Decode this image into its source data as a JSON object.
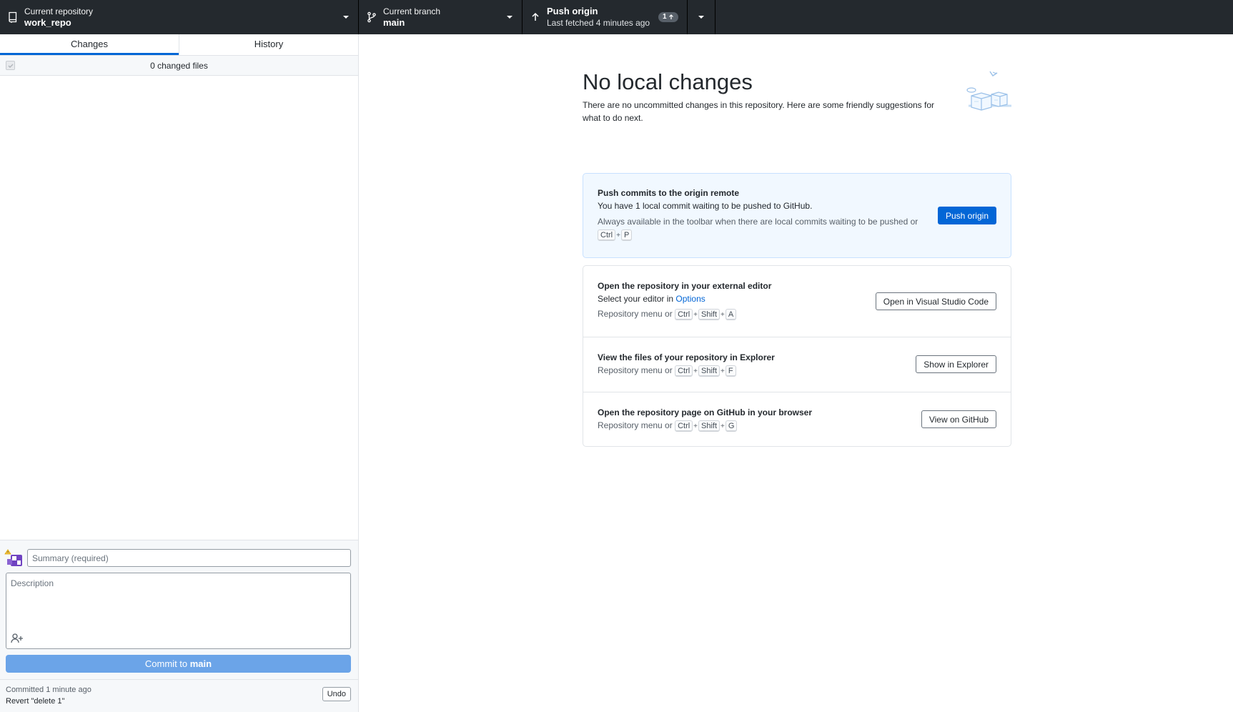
{
  "toolbar": {
    "repo": {
      "label": "Current repository",
      "value": "work_repo"
    },
    "branch": {
      "label": "Current branch",
      "value": "main"
    },
    "push": {
      "label": "Push origin",
      "subtext": "Last fetched 4 minutes ago",
      "ahead_count": "1"
    }
  },
  "sidebar": {
    "tabs": [
      {
        "label": "Changes",
        "selected": true
      },
      {
        "label": "History",
        "selected": false
      }
    ],
    "changed_files": "0 changed files",
    "commit": {
      "summary_placeholder": "Summary (required)",
      "description_placeholder": "Description",
      "button_prefix": "Commit to ",
      "button_branch": "main"
    },
    "undo": {
      "line1": "Committed 1 minute ago",
      "line2": "Revert \"delete 1\"",
      "button": "Undo"
    }
  },
  "main": {
    "title": "No local changes",
    "subtitle": "There are no uncommitted changes in this repository. Here are some friendly suggestions for what to do next.",
    "push_card": {
      "title": "Push commits to the origin remote",
      "text": "You have 1 local commit waiting to be pushed to GitHub.",
      "hint": "Always available in the toolbar when there are local commits waiting to be pushed or",
      "keys": [
        "Ctrl",
        "P"
      ],
      "button": "Push origin"
    },
    "editor": {
      "title": "Open the repository in your external editor",
      "text_prefix": "Select your editor in ",
      "link": "Options",
      "hint": "Repository menu or",
      "keys": [
        "Ctrl",
        "Shift",
        "A"
      ],
      "button": "Open in Visual Studio Code"
    },
    "explorer": {
      "title": "View the files of your repository in Explorer",
      "hint": "Repository menu or",
      "keys": [
        "Ctrl",
        "Shift",
        "F"
      ],
      "button": "Show in Explorer"
    },
    "github": {
      "title": "Open the repository page on GitHub in your browser",
      "hint": "Repository menu or",
      "keys": [
        "Ctrl",
        "Shift",
        "G"
      ],
      "button": "View on GitHub"
    }
  },
  "colors": {
    "toolbar_bg": "#24292e",
    "accent": "#0366d6",
    "commit_button": "#6ba4e8",
    "push_card_bg": "#f1f8ff"
  }
}
